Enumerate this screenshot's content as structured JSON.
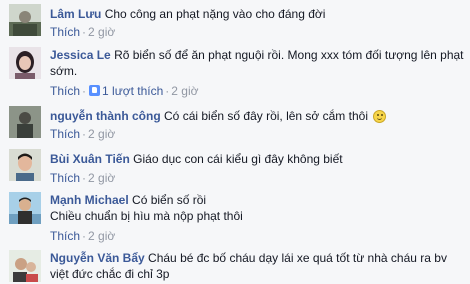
{
  "comments": [
    {
      "name": "Lâm Lưu",
      "text": "Cho công an phạt nặng vào cho đáng đời",
      "like": "Thích",
      "time": "2 giờ"
    },
    {
      "name": "Jessica Le",
      "text": "Rõ biển số để ăn phạt nguội rồi. Mong xxx tóm đối tượng lên phạt sớm.",
      "like": "Thích",
      "like_count": "1 lượt thích",
      "time": "2 giờ"
    },
    {
      "name": "nguyễn thành công",
      "text": "Có cái biển số đây rồi, lên sở cắm thôi",
      "like": "Thích",
      "time": "2 giờ",
      "emoji": "smile-emoji"
    },
    {
      "name": "Bùi Xuân Tiến",
      "text": "Giáo dục con cái kiểu gì đây không biết",
      "like": "Thích",
      "time": "2 giờ"
    },
    {
      "name": "Mạnh Michael",
      "text_line1": "Có biển số rồi",
      "text_line2": "Chiều chuẩn bị hìu mà nộp phạt thôi",
      "like": "Thích",
      "time": "2 giờ"
    },
    {
      "name": "Nguyễn Văn Bẩy",
      "text": "Cháu bé đc bố cháu dạy lái xe quá tốt từ nhà cháu ra bv việt đức chắc đi chỉ 3p"
    }
  ],
  "colors": {
    "name": "#3b5998",
    "meta": "#9197a3",
    "background": "#f6f7f9"
  }
}
